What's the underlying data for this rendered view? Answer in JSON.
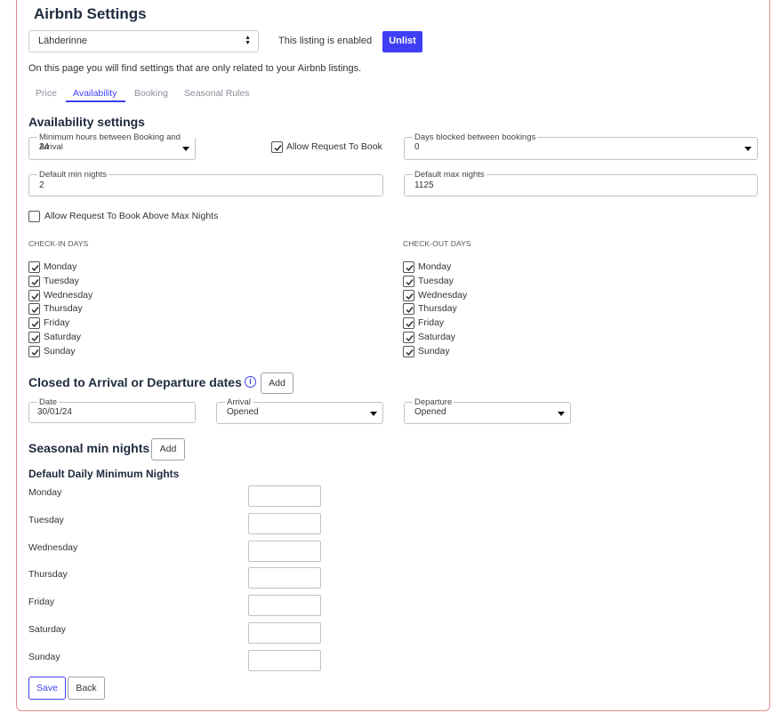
{
  "header": {
    "title": "Airbnb Settings"
  },
  "listing": {
    "selected": "Lähderinne",
    "status_text": "This listing is enabled",
    "unlist_label": "Unlist"
  },
  "intro_text": "On this page you will find settings that are only related to your Airbnb listings.",
  "tabs": [
    {
      "label": "Price",
      "active": false
    },
    {
      "label": "Availability",
      "active": true
    },
    {
      "label": "Booking",
      "active": false
    },
    {
      "label": "Seasonal Rules",
      "active": false
    }
  ],
  "availability": {
    "heading": "Availability settings",
    "min_hours": {
      "label": "Minimum hours between Booking and Arrival",
      "value": "24"
    },
    "allow_request_to_book": {
      "label": "Allow Request To Book",
      "checked": true
    },
    "days_blocked": {
      "label": "Days blocked between bookings",
      "value": "0"
    },
    "default_min_nights": {
      "label": "Default min nights",
      "value": "2"
    },
    "default_max_nights": {
      "label": "Default max nights",
      "value": "1125"
    },
    "allow_above_max": {
      "label": "Allow Request To Book Above Max Nights",
      "checked": false
    },
    "checkin_heading": "CHECK-IN DAYS",
    "checkout_heading": "CHECK-OUT DAYS",
    "checkin_days": [
      "Monday",
      "Tuesday",
      "Wednesday",
      "Thursday",
      "Friday",
      "Saturday",
      "Sunday"
    ],
    "checkout_days": [
      "Monday",
      "Tuesday",
      "Wednesday",
      "Thursday",
      "Friday",
      "Saturday",
      "Sunday"
    ]
  },
  "closed_dates": {
    "heading": "Closed to Arrival or Departure dates",
    "info_icon": "info-icon",
    "add_label": "Add",
    "date": {
      "label": "Date",
      "value": "30/01/24"
    },
    "arrival": {
      "label": "Arrival",
      "value": "Opened"
    },
    "departure": {
      "label": "Departure",
      "value": "Opened"
    }
  },
  "seasonal": {
    "heading": "Seasonal min nights",
    "add_label": "Add",
    "daily_heading": "Default Daily Minimum Nights",
    "days": [
      "Monday",
      "Tuesday",
      "Wednesday",
      "Thursday",
      "Friday",
      "Saturday",
      "Sunday"
    ]
  },
  "footer": {
    "save_label": "Save",
    "back_label": "Back"
  },
  "colors": {
    "accent": "#3e3ef5",
    "panel_border": "#e38a92",
    "heading": "#1e2a3d"
  }
}
